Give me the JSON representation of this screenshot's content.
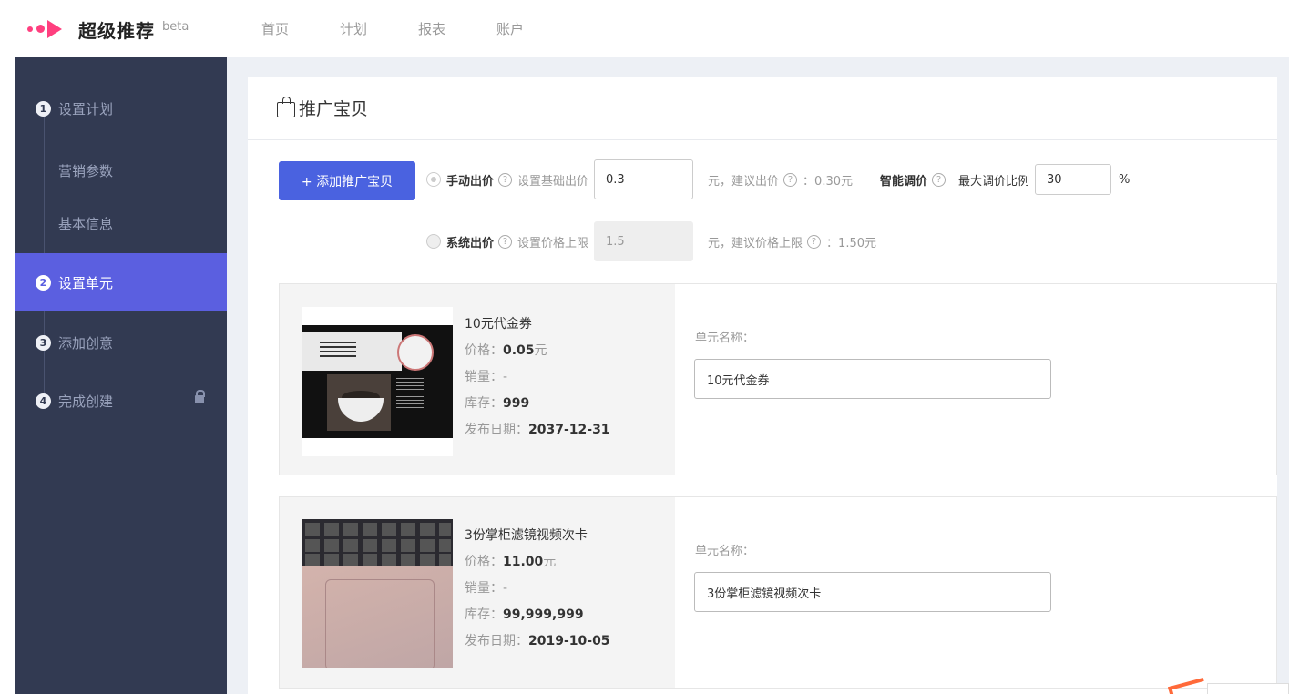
{
  "app": {
    "name": "超级推荐",
    "beta": "beta"
  },
  "nav": {
    "items": [
      "首页",
      "计划",
      "报表",
      "账户"
    ]
  },
  "sidebar": {
    "steps": [
      {
        "num": "1",
        "label": "设置计划"
      },
      {
        "label": "营销参数"
      },
      {
        "label": "基本信息"
      },
      {
        "num": "2",
        "label": "设置单元"
      },
      {
        "num": "3",
        "label": "添加创意"
      },
      {
        "num": "4",
        "label": "完成创建"
      }
    ]
  },
  "panel": {
    "title": "推广宝贝"
  },
  "bidding": {
    "add_button": "+ 添加推广宝贝",
    "manual": {
      "label": "手动出价",
      "field_label": "设置基础出价",
      "value": "0.3",
      "suggest_prefix": "元，建议出价",
      "suggest_value": "：0.30元"
    },
    "smart": {
      "label": "智能调价",
      "max_ratio_label": "最大调价比例",
      "max_ratio_value": "30",
      "unit": "%"
    },
    "system": {
      "label": "系统出价",
      "field_label": "设置价格上限",
      "value": "1.5",
      "suggest_prefix": "元，建议价格上限",
      "suggest_value": "：1.50元"
    },
    "help": "?"
  },
  "products": [
    {
      "name": "10元代金券",
      "price_label": "价格：",
      "price": "0.05",
      "price_unit": "元",
      "sales_label": "销量：",
      "sales": "-",
      "stock_label": "库存：",
      "stock": "999",
      "date_label": "发布日期：",
      "date": "2037-12-31",
      "unit_name_label": "单元名称：",
      "unit_name": "10元代金券"
    },
    {
      "name": "3份掌柜滤镜视频次卡",
      "price_label": "价格：",
      "price": "11.00",
      "price_unit": "元",
      "sales_label": "销量：",
      "sales": "-",
      "stock_label": "库存：",
      "stock": "99,999,999",
      "date_label": "发布日期：",
      "date": "2019-10-05",
      "unit_name_label": "单元名称：",
      "unit_name": "3份掌柜滤镜视频次卡"
    }
  ],
  "colors": {
    "brand": "#ff3f7f",
    "sidebar_bg": "#323a52",
    "sidebar_active": "#5b5fe0",
    "primary_button": "#4a62e0"
  }
}
